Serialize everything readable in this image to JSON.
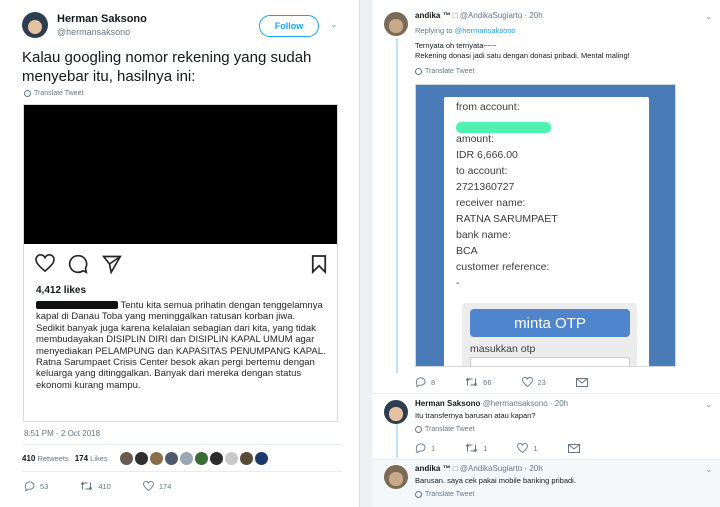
{
  "left": {
    "author": {
      "name": "Herman Saksono",
      "handle": "@hermansaksono"
    },
    "follow_label": "Follow",
    "text": "Kalau googling nomor rekening yang sudah menyebar itu, hasilnya ini:",
    "translate_label": "Translate Tweet",
    "instagram": {
      "likes": "4,412 likes",
      "caption": [
        "Tentu kita semua prihatin dengan tenggelamnya kapal di Danau Toba yang meninggalkan ratusan korban jiwa.",
        "Sedikit banyak juga karena kelalaian sebagian dari kita, yang tidak membudayakan DISIPLIN DIRI dan DISIPLIN KAPAL UMUM agar menyediakan PELAMPUNG dan KAPASITAS PENUMPANG KAPAL.",
        "Ratna Sarumpaet Crisis Center besok akan pergi bertemu dengan keluarga yang ditinggalkan. Banyak dari mereka dengan status ekonomi kurang mampu."
      ]
    },
    "timestamp": "8:51 PM - 2 Oct 2018",
    "retweets_count": "410",
    "retweets_label": "Retweets",
    "likes_count": "174",
    "likes_label": "Likes",
    "actions": {
      "replies": "53",
      "retweets": "410",
      "likes": "174"
    },
    "liker_colors": [
      "#6b5b4f",
      "#2f2f2f",
      "#8a6e4b",
      "#4d5b6a",
      "#9aa7b5",
      "#3a6b35",
      "#2b2b2b",
      "#c9c9c9",
      "#5a4a3a",
      "#1b3a6b"
    ]
  },
  "right": {
    "tweet1": {
      "name": "andika ™",
      "handle": "@AndikaSugiarto",
      "time": "20h",
      "replying_prefix": "Replying to",
      "replying_to": "@hermansaksono",
      "line1": "Ternyata oh ternyata~~~",
      "line2": "Rekening donasi jadi satu dengan donasi pribadi. Mental maling!",
      "translate_label": "Translate Tweet",
      "screenshot": {
        "from_label": "from account:",
        "amount_label": "amount:",
        "amount": "IDR 6,666.00",
        "to_label": "to account:",
        "to_account": "2721360727",
        "receiver_label": "receiver name:",
        "receiver": "RATNA SARUMPAET",
        "bank_label": "bank name:",
        "bank": "BCA",
        "ref_label": "customer reference:",
        "ref": "-",
        "otp_button": "minta OTP",
        "otp_label": "masukkan otp"
      },
      "replies": "8",
      "retweets": "66",
      "likes": "23"
    },
    "tweet2": {
      "name": "Herman Saksono",
      "handle": "@hermansaksono",
      "time": "20h",
      "text": "Itu transfernya barusan atau kapan?",
      "translate_label": "Translate Tweet",
      "replies": "1",
      "retweets": "1",
      "likes": "1"
    },
    "tweet3": {
      "name": "andika ™",
      "handle": "@AndikaSugiarto",
      "time": "20h",
      "text": "Barusan. saya cek pakai mobile banking pribadi.",
      "translate_label": "Translate Tweet"
    }
  }
}
